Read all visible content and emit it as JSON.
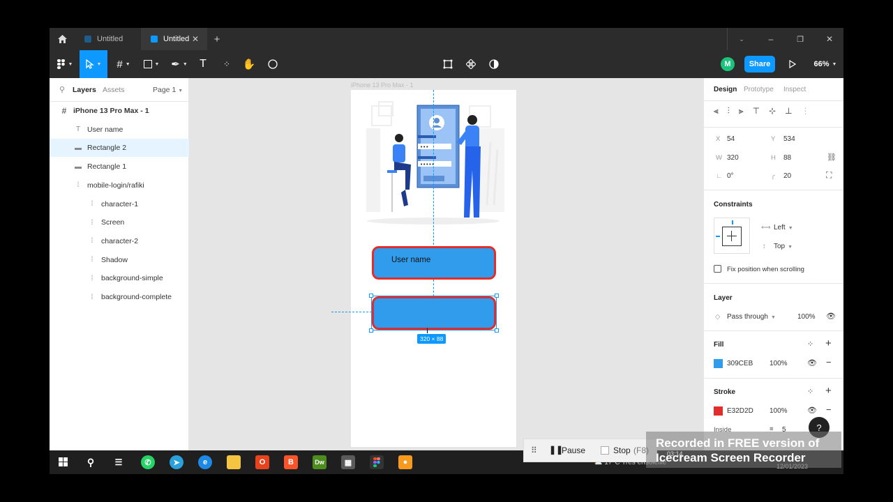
{
  "tabs": [
    {
      "label": "Untitled",
      "active": false
    },
    {
      "label": "Untitled",
      "active": true
    }
  ],
  "toolbar": {
    "share_label": "Share",
    "zoom": "66%",
    "avatar_letter": "M"
  },
  "left_panel": {
    "tabs": [
      "Layers",
      "Assets"
    ],
    "page": "Page 1",
    "layers": [
      {
        "name": "iPhone 13 Pro Max - 1",
        "icon": "frame-icon",
        "level": 0
      },
      {
        "name": "User name",
        "icon": "text-icon",
        "level": 1
      },
      {
        "name": "Rectangle 2",
        "icon": "rectangle-icon",
        "level": 1,
        "selected": true
      },
      {
        "name": "Rectangle 1",
        "icon": "rectangle-icon",
        "level": 1
      },
      {
        "name": "mobile-login/rafiki",
        "icon": "group-icon",
        "level": 1
      },
      {
        "name": "character-1",
        "icon": "group-icon",
        "level": 2
      },
      {
        "name": "Screen",
        "icon": "group-icon",
        "level": 2
      },
      {
        "name": "character-2",
        "icon": "group-icon",
        "level": 2
      },
      {
        "name": "Shadow",
        "icon": "group-icon",
        "level": 2
      },
      {
        "name": "background-simple",
        "icon": "group-icon",
        "level": 2
      },
      {
        "name": "background-complete",
        "icon": "group-icon",
        "level": 2
      }
    ]
  },
  "canvas": {
    "frame_label": "iPhone 13 Pro Max - 1",
    "username_text": "User name",
    "size_badge": "320 × 88",
    "input_fill": "#309CEB",
    "input_stroke": "#E32D2D"
  },
  "right_panel": {
    "tabs": [
      "Design",
      "Prototype",
      "Inspect"
    ],
    "x_label": "X",
    "x": "54",
    "y_label": "Y",
    "y": "534",
    "w_label": "W",
    "w": "320",
    "h_label": "H",
    "h": "88",
    "rotation": "0°",
    "radius": "20",
    "constraints_title": "Constraints",
    "constraint_h": "Left",
    "constraint_v": "Top",
    "fix_position": "Fix position when scrolling",
    "layer_title": "Layer",
    "blend": "Pass through",
    "layer_opacity": "100%",
    "fill_title": "Fill",
    "fill_hex": "309CEB",
    "fill_opacity": "100%",
    "stroke_title": "Stroke",
    "stroke_hex": "E32D2D",
    "stroke_opacity": "100%",
    "stroke_align": "Inside",
    "stroke_width": "5"
  },
  "recorder": {
    "pause": "Pause",
    "stop": "Stop",
    "stop_key": "(F8)",
    "time": "03:14",
    "watermark_line1": "Recorded in FREE version of",
    "watermark_line2": "Icecream Screen Recorder"
  },
  "taskbar": {
    "weather": "17°C  Très ensoleillé",
    "date": "12/01/2023"
  }
}
